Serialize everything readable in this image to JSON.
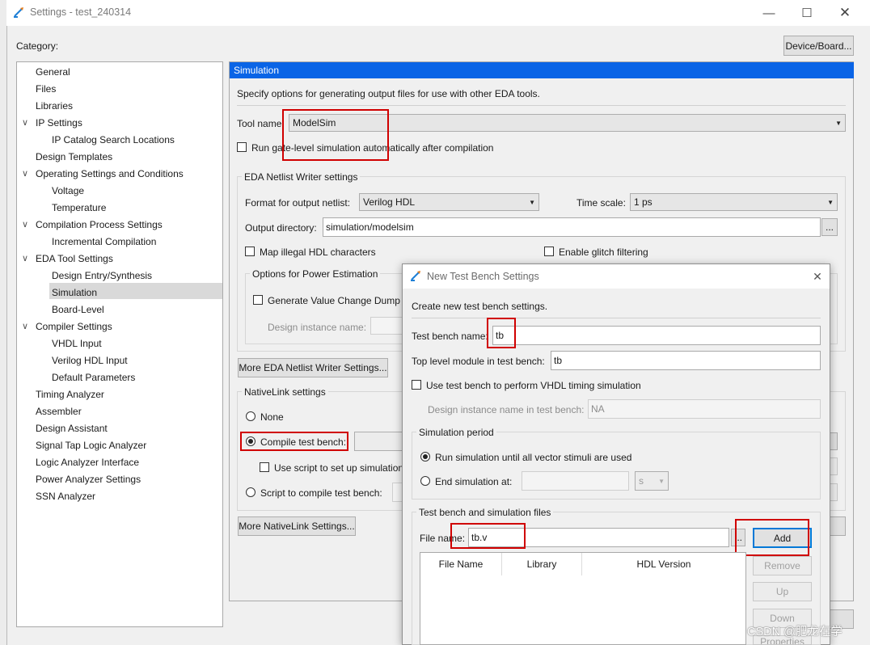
{
  "window": {
    "title": "Settings - test_240314",
    "minimize_icon": "minimize",
    "maximize_icon": "maximize",
    "close_icon": "close"
  },
  "category_label": "Category:",
  "device_board_button": "Device/Board...",
  "tree": [
    {
      "label": "General"
    },
    {
      "label": "Files"
    },
    {
      "label": "Libraries"
    },
    {
      "label": "IP Settings",
      "expanded": true
    },
    {
      "label": "IP Catalog Search Locations"
    },
    {
      "label": "Design Templates"
    },
    {
      "label": "Operating Settings and Conditions",
      "expanded": true
    },
    {
      "label": "Voltage"
    },
    {
      "label": "Temperature"
    },
    {
      "label": "Compilation Process Settings",
      "expanded": true
    },
    {
      "label": "Incremental Compilation"
    },
    {
      "label": "EDA Tool Settings",
      "expanded": true
    },
    {
      "label": "Design Entry/Synthesis"
    },
    {
      "label": "Simulation",
      "selected": true
    },
    {
      "label": "Board-Level"
    },
    {
      "label": "Compiler Settings",
      "expanded": true
    },
    {
      "label": "VHDL Input"
    },
    {
      "label": "Verilog HDL Input"
    },
    {
      "label": "Default Parameters"
    },
    {
      "label": "Timing Analyzer"
    },
    {
      "label": "Assembler"
    },
    {
      "label": "Design Assistant"
    },
    {
      "label": "Signal Tap Logic Analyzer"
    },
    {
      "label": "Logic Analyzer Interface"
    },
    {
      "label": "Power Analyzer Settings"
    },
    {
      "label": "SSN Analyzer"
    }
  ],
  "sim": {
    "header": "Simulation",
    "description": "Specify options for generating output files for use with other EDA tools.",
    "tool_name_label": "Tool name:",
    "tool_name_value": "ModelSim",
    "run_gate_level": "Run gate-level simulation automatically after compilation",
    "eda_group": "EDA Netlist Writer settings",
    "format_label": "Format for output netlist:",
    "format_value": "Verilog HDL",
    "timescale_label": "Time scale:",
    "timescale_value": "1 ps",
    "output_dir_label": "Output directory:",
    "output_dir_value": "simulation/modelsim",
    "browse": "...",
    "map_illegal": "Map illegal HDL characters",
    "enable_glitch": "Enable glitch filtering",
    "power_group": "Options for Power Estimation",
    "gen_vcd": "Generate Value Change Dump (",
    "design_instance_label": "Design instance name:",
    "more_eda": "More EDA Netlist Writer Settings...",
    "nativelink_group": "NativeLink settings",
    "none_label": "None",
    "compile_tb_label": "Compile test bench:",
    "use_script_label": "Use script to set up simulation",
    "script_compile_label": "Script to compile test bench:",
    "more_nativelink": "More NativeLink Settings..."
  },
  "dialog": {
    "title": "New Test Bench Settings",
    "close_icon": "close",
    "create_label": "Create new test bench settings.",
    "tb_name_label": "Test bench name:",
    "tb_name_value": "tb",
    "top_module_label": "Top level module in test bench:",
    "top_module_value": "tb",
    "use_vhdl_timing": "Use test bench to perform VHDL timing simulation",
    "design_inst_label": "Design instance name in test bench:",
    "design_inst_value": "NA",
    "sim_period_group": "Simulation period",
    "run_until": "Run simulation until all vector stimuli are used",
    "end_sim_at": "End simulation at:",
    "end_unit": "s",
    "files_group": "Test bench and simulation files",
    "file_name_label": "File name:",
    "file_name_value": "tb.v",
    "browse": "...",
    "add": "Add",
    "remove": "Remove",
    "up": "Up",
    "down": "Down",
    "properties": "Properties",
    "columns": [
      "File Name",
      "Library",
      "HDL Version"
    ]
  },
  "watermark": "CSDN @肥龙在学"
}
